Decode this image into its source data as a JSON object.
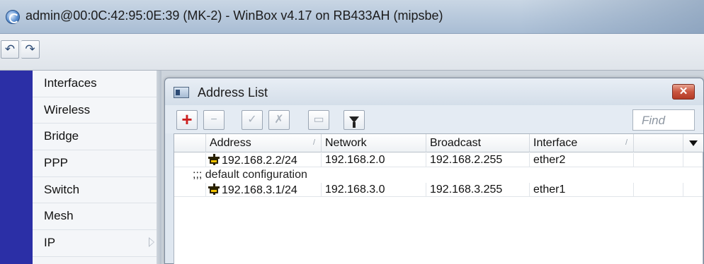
{
  "window": {
    "title": "admin@00:0C:42:95:0E:39 (MK-2) - WinBox v4.17 on RB433AH (mipsbe)"
  },
  "toolbar": {
    "undo_icon": "undo-icon",
    "redo_icon": "redo-icon",
    "undo_glyph": "↶",
    "redo_glyph": "↷"
  },
  "sidebar": {
    "accent_color": "#2b2fa6",
    "items": [
      {
        "label": "Interfaces"
      },
      {
        "label": "Wireless"
      },
      {
        "label": "Bridge"
      },
      {
        "label": "PPP"
      },
      {
        "label": "Switch"
      },
      {
        "label": "Mesh"
      },
      {
        "label": "IP",
        "has_submenu": true
      }
    ]
  },
  "address_list": {
    "title": "Address List",
    "close_glyph": "✕",
    "buttons": {
      "add_glyph": "+",
      "remove_glyph": "−",
      "enable_glyph": "✓",
      "disable_glyph": "✗",
      "comment_glyph": "▭"
    },
    "find_placeholder": "Find",
    "columns": [
      "Address",
      "Network",
      "Broadcast",
      "Interface"
    ],
    "rows": [
      {
        "address": "192.168.2.2/24",
        "network": "192.168.2.0",
        "broadcast": "192.168.2.255",
        "interface": "ether2"
      },
      {
        "comment": ";;; default configuration"
      },
      {
        "address": "192.168.3.1/24",
        "network": "192.168.3.0",
        "broadcast": "192.168.3.255",
        "interface": "ether1"
      }
    ]
  }
}
